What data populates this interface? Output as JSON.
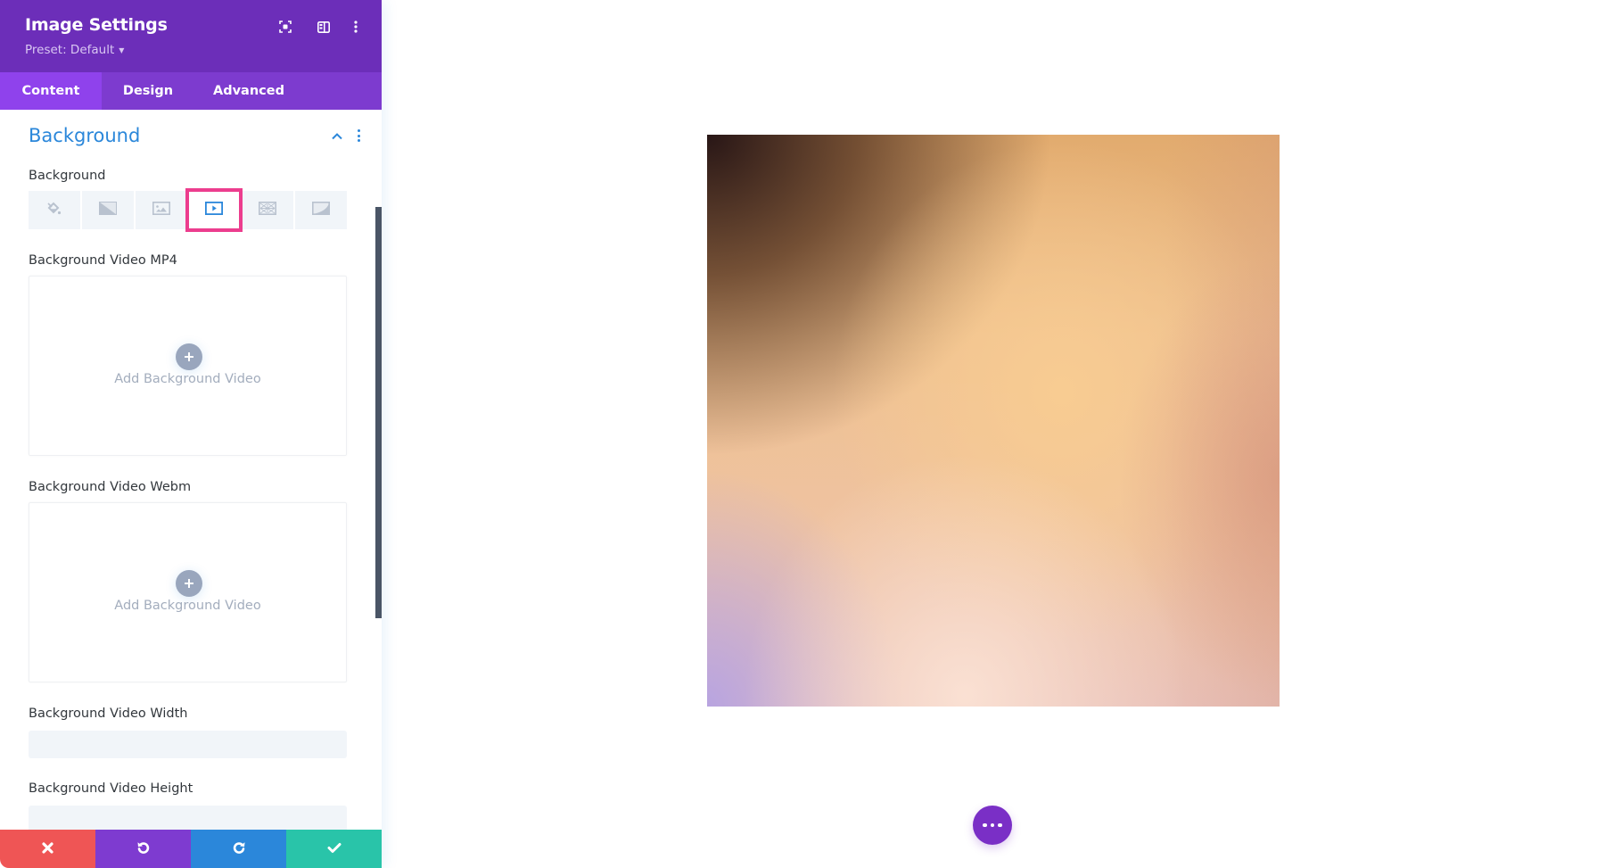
{
  "panel": {
    "title": "Image Settings",
    "preset_label": "Preset: Default",
    "header_icons": [
      "focus-mode-icon",
      "split-view-icon",
      "more-options-icon"
    ],
    "tabs": [
      {
        "label": "Content",
        "active": true
      },
      {
        "label": "Design",
        "active": false
      },
      {
        "label": "Advanced",
        "active": false
      }
    ],
    "section": {
      "title": "Background",
      "expanded": true
    },
    "fields": {
      "background_label": "Background",
      "background_types": [
        {
          "name": "color",
          "icon": "paint-bucket-icon",
          "active": false
        },
        {
          "name": "gradient",
          "icon": "gradient-icon",
          "active": false
        },
        {
          "name": "image",
          "icon": "image-icon",
          "active": false
        },
        {
          "name": "video",
          "icon": "video-icon",
          "active": true
        },
        {
          "name": "pattern",
          "icon": "pattern-icon",
          "active": false
        },
        {
          "name": "mask",
          "icon": "mask-icon",
          "active": false
        }
      ],
      "video_mp4_label": "Background Video MP4",
      "video_mp4_upload": "Add Background Video",
      "video_webm_label": "Background Video Webm",
      "video_webm_upload": "Add Background Video",
      "video_width_label": "Background Video Width",
      "video_width_value": "",
      "video_height_label": "Background Video Height",
      "video_height_value": ""
    },
    "toolbar": [
      {
        "name": "discard",
        "icon": "close-icon",
        "color": "#ef5555"
      },
      {
        "name": "undo",
        "icon": "undo-icon",
        "color": "#7e3bd0"
      },
      {
        "name": "redo",
        "icon": "redo-icon",
        "color": "#2b87da"
      },
      {
        "name": "save",
        "icon": "check-icon",
        "color": "#29c4a9"
      }
    ]
  },
  "canvas": {
    "module": "image",
    "fab_icon": "more-horizontal-icon"
  },
  "colors": {
    "header": "#6c2eb9",
    "tabs": "#7d3bcf",
    "active_tab": "#8f42ec",
    "accent_blue": "#2b87da",
    "highlight_pink": "#ec3d8e",
    "fab": "#7a2fc6"
  }
}
